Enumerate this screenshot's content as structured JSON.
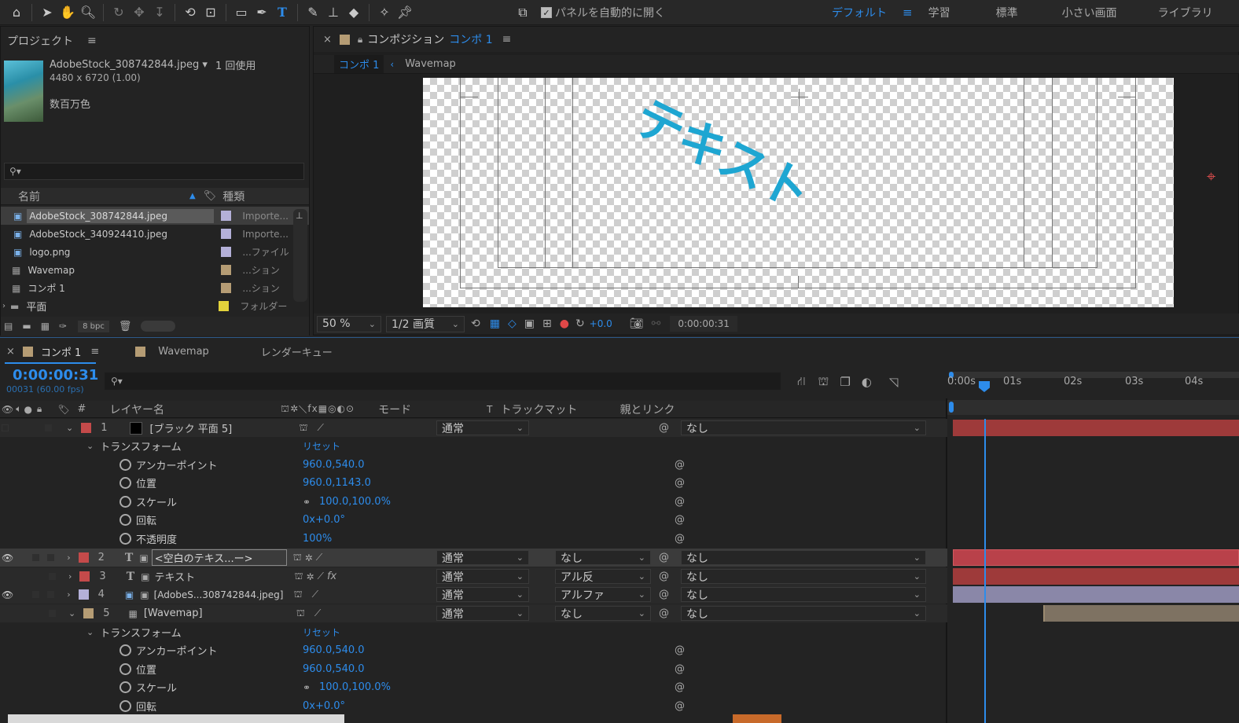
{
  "toolbar": {
    "auto_open_label": "パネルを自動的に開く",
    "workspaces": [
      "デフォルト",
      "学習",
      "標準",
      "小さい画面",
      "ライブラリ"
    ]
  },
  "project": {
    "title": "プロジェクト",
    "selected_file": "AdobeStock_308742844.jpeg ▾",
    "usage": "1 回使用",
    "dimensions": "4480 x 6720 (1.00)",
    "colors": "数百万色",
    "search_placeholder": "",
    "col_name": "名前",
    "col_type": "種類",
    "bpc": "8 bpc",
    "items": [
      {
        "name": "AdobeStock_308742844.jpeg",
        "type": "Importe...",
        "color": "#b4b0d8",
        "icon": "image-file-icon"
      },
      {
        "name": "AdobeStock_340924410.jpeg",
        "type": "Importe...",
        "color": "#b4b0d8",
        "icon": "image-file-icon"
      },
      {
        "name": "logo.png",
        "type": "...ファイル",
        "color": "#b4b0d8",
        "icon": "image-file-icon"
      },
      {
        "name": "Wavemap",
        "type": "...ション",
        "color": "#b59c74",
        "icon": "composition-icon"
      },
      {
        "name": "コンポ 1",
        "type": "...ション",
        "color": "#b59c74",
        "icon": "composition-icon"
      },
      {
        "name": "平面",
        "type": "フォルダー",
        "color": "#e3d33b",
        "icon": "folder-icon"
      }
    ]
  },
  "composition": {
    "title_prefix": "コンポジション",
    "comp_name": "コンポ 1",
    "breadcrumb_active": "コンポ 1",
    "breadcrumb_next": "Wavemap",
    "canvas_text": "テキスト",
    "zoom": "50 %",
    "resolution": "1/2 画質",
    "exposure": "+0.0",
    "timecode": "0:00:00:31"
  },
  "timeline": {
    "tabs": [
      {
        "label": "コンポ 1",
        "color": "#b59c74"
      },
      {
        "label": "Wavemap",
        "color": "#b59c74"
      },
      {
        "label": "レンダーキュー",
        "color": ""
      }
    ],
    "current_time": "0:00:00:31",
    "frame_info": "00031 (60.00 fps)",
    "col_layer_name": "レイヤー名",
    "col_mode": "モード",
    "col_t": "T",
    "col_track_matte": "トラックマット",
    "col_parent": "親とリンク",
    "col_num": "#",
    "ruler": [
      "0:00s",
      "01s",
      "02s",
      "03s",
      "04s"
    ],
    "transform_label": "トランスフォーム",
    "reset_label": "リセット",
    "layers": [
      {
        "num": "1",
        "name": "[ブラック 平面 5]",
        "label_color": "#c44a4a",
        "mode": "通常",
        "matte": "",
        "parent": "なし",
        "bar_color": "#9e3a3a"
      },
      {
        "num": "2",
        "name": "<空白のテキス...ー>",
        "label_color": "#c44a4a",
        "mode": "通常",
        "matte": "なし",
        "parent": "なし",
        "bar_color": "#b9414a"
      },
      {
        "num": "3",
        "name": "テキスト",
        "label_color": "#c44a4a",
        "mode": "通常",
        "matte": "アル反",
        "parent": "なし",
        "bar_color": "#9e3a3a"
      },
      {
        "num": "4",
        "name": "[AdobeS...308742844.jpeg]",
        "label_color": "#b4b0d8",
        "mode": "通常",
        "matte": "アルファ",
        "parent": "なし",
        "bar_color": "#8a87a8"
      },
      {
        "num": "5",
        "name": "[Wavemap]",
        "label_color": "#b59c74",
        "mode": "通常",
        "matte": "なし",
        "parent": "なし",
        "bar_color": "#7e7262"
      }
    ],
    "props1": [
      {
        "name": "アンカーポイント",
        "value": "960.0,540.0"
      },
      {
        "name": "位置",
        "value": "960.0,1143.0"
      },
      {
        "name": "スケール",
        "value": "100.0,100.0%"
      },
      {
        "name": "回転",
        "value": "0x+0.0°"
      },
      {
        "name": "不透明度",
        "value": "100%"
      }
    ],
    "props5": [
      {
        "name": "アンカーポイント",
        "value": "960.0,540.0"
      },
      {
        "name": "位置",
        "value": "960.0,540.0"
      },
      {
        "name": "スケール",
        "value": "100.0,100.0%"
      },
      {
        "name": "回転",
        "value": "0x+0.0°"
      }
    ]
  }
}
